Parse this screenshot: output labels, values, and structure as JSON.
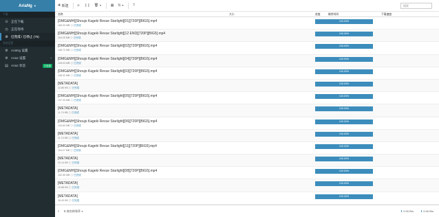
{
  "sidebar": {
    "brand": "AriaNg",
    "section_download": "下载",
    "nav_downloading": "正在下载",
    "nav_waiting": "正在等待",
    "nav_stopped": "已完成 / 已停止 (76)",
    "section_settings": "系统设置",
    "nav_ariang_settings": "AriaNg 设置",
    "nav_aria2_settings": "Aria2 设置",
    "nav_aria2_status": "Aria2 状态",
    "aria2_status_badge": "已连接"
  },
  "toolbar": {
    "new_label": "新建",
    "search_placeholder": "搜索"
  },
  "table": {
    "col_name": "名称",
    "col_size": "大小",
    "col_progress": "进度",
    "col_remaining": "剩余时间",
    "col_speed": "下载速度"
  },
  "tasks": [
    {
      "name": "[DMG&MH][Shoujo Kageki Revue Starlight][01][720P][BIG5].mp4",
      "size": "165.00 MB",
      "progress": "100.00%",
      "link": "已完成"
    },
    {
      "name": "[DMG&MH][Shoujo Kageki Revue Starlight][12 END][720P][BIG5].mp4",
      "size": "118.25 MB",
      "progress": "100.00%",
      "link": "已完成"
    },
    {
      "name": "[DMG&MH][Shoujo Kageki Revue Starlight][02][720P][BIG5].mp4",
      "size": "148.72 MB",
      "progress": "100.00%",
      "link": "已完成"
    },
    {
      "name": "[DMG&MH][Shoujo Kageki Revue Starlight][04][720P][BIG5].mp4",
      "size": "128.03 MB",
      "progress": "100.00%",
      "link": "已完成"
    },
    {
      "name": "[DMG&MH][Shoujo Kageki Revue Starlight][03][720P][BIG5].mp4",
      "size": "148.32 MB",
      "progress": "100.00%",
      "link": "已完成"
    },
    {
      "name": "[METADATA]",
      "size": "12.86 KB",
      "progress": "100.00%",
      "link": "已完成"
    },
    {
      "name": "[DMG&MH][Shoujo Kageki Revue Starlight][05][720P][BIG5].mp4",
      "size": "137.33 MB",
      "progress": "100.00%",
      "link": "已完成"
    },
    {
      "name": "[METADATA]",
      "size": "11.74 KB",
      "progress": "100.00%",
      "link": "已完成"
    },
    {
      "name": "[DMG&MH][Shoujo Kageki Revue Starlight][06][720P][BIG5].mp4",
      "size": "134.60 MB",
      "progress": "100.00%",
      "link": "已完成"
    },
    {
      "name": "[METADATA]",
      "size": "11.74 KB",
      "progress": "100.00%",
      "link": "已完成"
    },
    {
      "name": "[DMG&MH][Shoujo Kageki Revue Starlight][11][720P][BIG5].mp4",
      "size": "116.27 MB",
      "progress": "100.00%",
      "link": "已完成"
    },
    {
      "name": "[METADATA]",
      "size": "10.14 KB",
      "progress": "100.00%",
      "link": "已完成"
    },
    {
      "name": "[DMG&MH][Shoujo Kageki Revue Starlight][08][720P][BIG5].mp4",
      "size": "152.55 MB",
      "progress": "100.00%",
      "link": "已完成"
    },
    {
      "name": "[METADATA]",
      "size": "10.88 KB",
      "progress": "100.00%",
      "link": "已完成"
    },
    {
      "name": "[METADATA]",
      "size": "18.43 KB",
      "progress": "100.00%",
      "link": "已完成"
    }
  ],
  "footer": {
    "sort_label": "按名称排序",
    "upload_speed": "0.00 B/s",
    "download_speed": "0.00 B/s"
  },
  "colors": {
    "accent": "#3c8dbc",
    "sidebar_bg": "#222d32",
    "badge": "#00a65a"
  }
}
